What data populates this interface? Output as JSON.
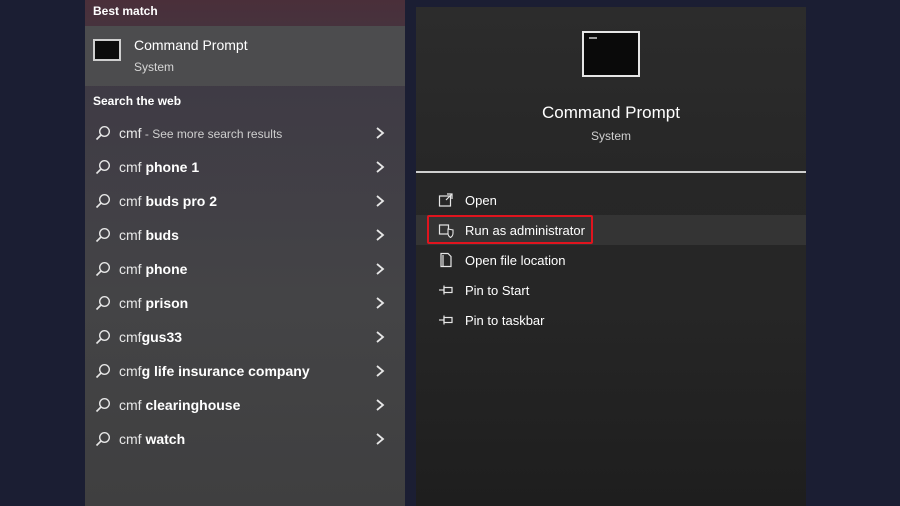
{
  "best_match": {
    "section_title": "Best match",
    "title": "Command Prompt",
    "subtitle": "System"
  },
  "web": {
    "section_title": "Search the web",
    "items": [
      {
        "query": "cmf",
        "bold": "",
        "suffix": " - See more search results"
      },
      {
        "query": "cmf ",
        "bold": "phone 1",
        "suffix": ""
      },
      {
        "query": "cmf ",
        "bold": "buds pro 2",
        "suffix": ""
      },
      {
        "query": "cmf ",
        "bold": "buds",
        "suffix": ""
      },
      {
        "query": "cmf ",
        "bold": "phone",
        "suffix": ""
      },
      {
        "query": "cmf ",
        "bold": "prison",
        "suffix": ""
      },
      {
        "query": "cmf",
        "bold": "gus33",
        "suffix": ""
      },
      {
        "query": "cmf",
        "bold": "g life insurance company",
        "suffix": ""
      },
      {
        "query": "cmf ",
        "bold": "clearinghouse",
        "suffix": ""
      },
      {
        "query": "cmf ",
        "bold": "watch",
        "suffix": ""
      }
    ]
  },
  "detail": {
    "title": "Command Prompt",
    "subtitle": "System",
    "actions": [
      {
        "label": "Open",
        "icon": "open-icon"
      },
      {
        "label": "Run as administrator",
        "icon": "shield-icon"
      },
      {
        "label": "Open file location",
        "icon": "file-location-icon"
      },
      {
        "label": "Pin to Start",
        "icon": "pin-icon"
      },
      {
        "label": "Pin to taskbar",
        "icon": "pin-icon"
      }
    ]
  },
  "colors": {
    "highlight_box": "#e0141e",
    "background": "#1b1e33"
  }
}
